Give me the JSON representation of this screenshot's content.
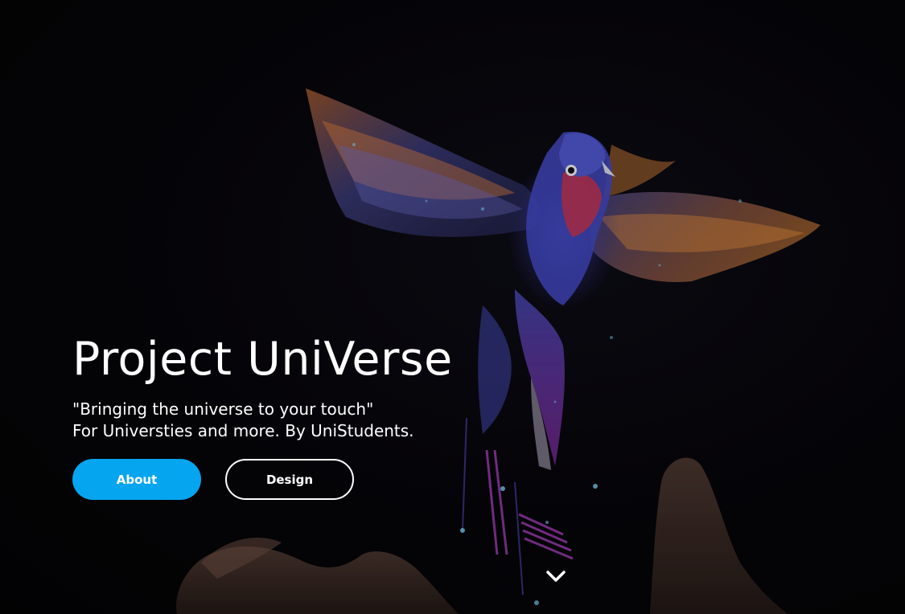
{
  "hero": {
    "title": "Project UniVerse",
    "tagline_line1": "\"Bringing the universe to your touch\"",
    "tagline_line2": "For Universties and more. By UniStudents.",
    "background_image": "hummingbird-hologram-over-hand",
    "buttons": {
      "about_label": "About",
      "design_label": "Design"
    },
    "scroll_icon": "chevron-down-icon"
  },
  "colors": {
    "background": "#050406",
    "accent": "#05a5ef",
    "text": "#ffffff"
  }
}
